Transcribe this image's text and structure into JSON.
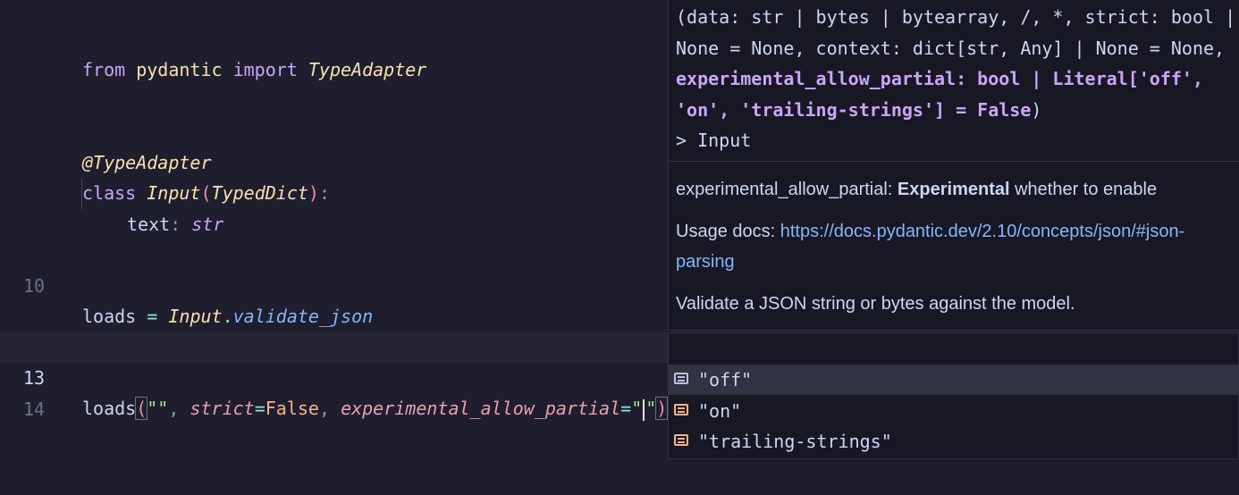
{
  "editor": {
    "line_numbers": {
      "l10": "10",
      "l13": "13",
      "l14": "14"
    },
    "line1": {
      "from": "from",
      "module": "pydantic",
      "import": "import",
      "name": "TypeAdapter"
    },
    "line4": {
      "decorator": "@TypeAdapter"
    },
    "line5": {
      "class_kw": "class",
      "class_name": "Input",
      "open": "(",
      "base": "TypedDict",
      "close": ")",
      "colon": ":"
    },
    "line6": {
      "field": "text",
      "colon": ":",
      "type": "str"
    },
    "line11": {
      "var": "loads",
      "eq": "=",
      "obj": "Input",
      "dot": ".",
      "method": "validate_json"
    },
    "line13": {
      "func": "loads",
      "open": "(",
      "arg1": "\"\"",
      "comma1": ",",
      "kw1": "strict",
      "eq1": "=",
      "val1": "False",
      "comma2": ",",
      "kw2": "experimental_allow_partial",
      "eq2": "=",
      "q_open": "\"",
      "q_close": "\"",
      "close": ")"
    }
  },
  "signature": {
    "pre": "(data: str | bytes | bytearray, /, *, strict: bool | None = None, context: dict[str, Any] | None = None, ",
    "active": "experimental_allow_partial: bool | Literal['off', 'on', 'trailing-strings'] = False",
    "post": ")\n> Input",
    "param_name": "experimental_allow_partial:",
    "param_emph": "Experimental",
    "param_desc": "whether to enable",
    "usage_label": "Usage docs:",
    "usage_link": "https://docs.pydantic.dev/2.10/concepts/json/#json-parsing",
    "summary": "Validate a JSON string or bytes against the model."
  },
  "completion": {
    "items": [
      "\"off\"",
      "\"on\"",
      "\"trailing-strings\""
    ],
    "icon": "text-value-icon",
    "selected_index": 0
  },
  "colors": {
    "background": "#1e1e2e",
    "keyword": "#cba6f7",
    "parameter": "#eba0ac",
    "method": "#89b4fa",
    "link": "#89b4fa",
    "value_icon": "#fab387"
  }
}
